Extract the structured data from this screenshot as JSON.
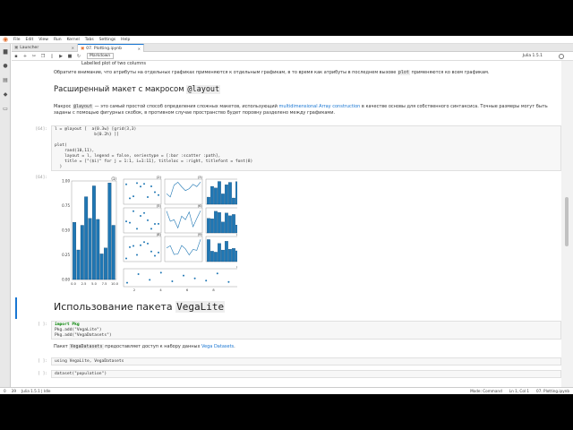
{
  "menu": [
    "File",
    "Edit",
    "View",
    "Run",
    "Kernel",
    "Tabs",
    "Settings",
    "Help"
  ],
  "tabs": [
    {
      "label": "Launcher",
      "active": false
    },
    {
      "label": "07. Plotting.ipynb",
      "active": true
    }
  ],
  "toolbar": {
    "cell_type": "Markdown",
    "kernel": "Julia 1.5.1"
  },
  "cells": {
    "top_fragment": "Labelled plot of two columns",
    "note": "Обратите внимание, что атрибуты на отдельных графиках применяются к отдельным графикам, в то время как атрибуты в последнем вызове",
    "note_code": "plot",
    "note_end": "применяются ко всем графикам.",
    "layout_heading": "Расширенный макет с макросом",
    "layout_heading_code": "@layout",
    "layout_p1a": "Макрос",
    "layout_p1_code": "@layout",
    "layout_p1b": "— это самый простой способ определения сложных макетов, использующий",
    "layout_p1_link": "multidimensional Array construction",
    "layout_p1c": "в качестве основы для собственного синтаксиса. Точные размеры могут быть",
    "layout_p2": "заданы с помощью фигурных скобок, в противном случае пространство будет поровну разделено между графиками.",
    "prompt_in_64": "[64]:",
    "prompt_out_64": "[64]:",
    "code_64": [
      "l = @layout [  a{0.3w} [grid(3,3)",
      "                b{0.2h} ]]",
      "",
      "plot(",
      "    rand(10,11),",
      "    layout = l, legend = false, seriestype = [:bar :scatter :path],",
      "    title = [\"($i)\" for j = 1:1, i=1:11], titleloc = :right, titlefont = font(8)",
      "  )"
    ],
    "vega_heading": "Использование пакета",
    "vega_heading_code": "VegaLite",
    "prompt_pkg": "[ ]:",
    "code_pkg": [
      "import Pkg",
      "Pkg.add(\"VegaLite\")",
      "Pkg.add(\"VegaDatasets\")"
    ],
    "vega_p_a": "Пакет",
    "vega_p_code": "VegaDatasets",
    "vega_p_b": "предоставляет доступ к набору данных",
    "vega_p_link": "Vega Datasets",
    "vega_p_c": ".",
    "prompt_using": "[ ]:",
    "code_using": "using VegaLite, VegaDatasets",
    "prompt_dataset": "[ ]:",
    "code_dataset": "dataset(\"population\")"
  },
  "plot": {
    "bar_color": "#1f77b4",
    "titles": [
      "(1)",
      "(2)",
      "(3)",
      "(4)",
      "(5)",
      "(6)",
      "(7)",
      "(8)",
      "(9)",
      "(10)",
      "(11)"
    ],
    "big_bar": {
      "values": [
        0.58,
        0.3,
        0.55,
        0.84,
        0.62,
        0.95,
        0.61,
        0.26,
        0.32,
        0.98,
        0.55
      ],
      "yticks": [
        "0.00",
        "0.25",
        "0.50",
        "0.75",
        "1.00"
      ],
      "xticks": [
        "0.0",
        "2.5",
        "5.0",
        "7.5",
        "10.0"
      ]
    },
    "bottom_scatter": {
      "values": [
        0.15,
        0.75,
        0.35,
        0.85,
        0.25,
        0.65,
        0.45,
        0.3,
        0.8,
        0.2,
        0.9
      ],
      "xticks": [
        "2",
        "4",
        "6",
        "8",
        "10"
      ]
    }
  },
  "status": {
    "left_mode": "0",
    "left_num": "39",
    "left_kernel": "Julia 1.5.1 | Idle",
    "mode": "Mode: Command",
    "cursor": "Ln 1, Col 1",
    "file": "07. Plotting.ipynb"
  }
}
